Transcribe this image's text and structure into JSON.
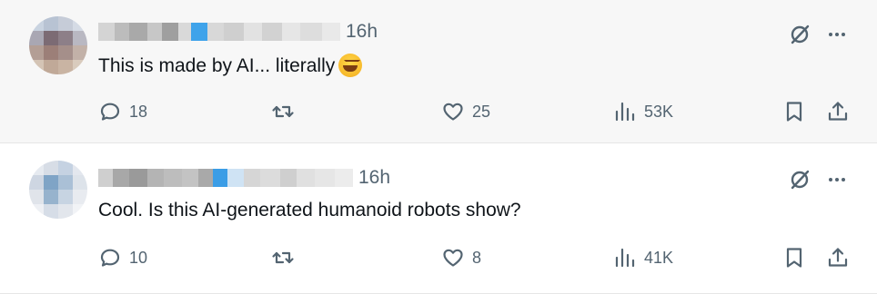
{
  "tweets": [
    {
      "time": "16h",
      "text": "This is made by AI... literally",
      "emoji": "grinning-squinting-face",
      "actions": {
        "replies": "18",
        "reposts": "",
        "likes": "25",
        "views": "53K"
      }
    },
    {
      "time": "16h",
      "text": "Cool. Is this AI-generated humanoid robots show?",
      "actions": {
        "replies": "10",
        "reposts": "",
        "likes": "8",
        "views": "41K"
      }
    }
  ],
  "icons": {
    "reply": "reply-icon",
    "repost": "repost-icon",
    "like": "heart-icon",
    "views": "views-icon",
    "bookmark": "bookmark-icon",
    "share": "share-icon",
    "grok": "grok-icon",
    "more": "more-icon"
  },
  "colors": {
    "icon": "#536471",
    "text": "#0f1419",
    "muted": "#536471",
    "accent": "#1d9bf0"
  }
}
